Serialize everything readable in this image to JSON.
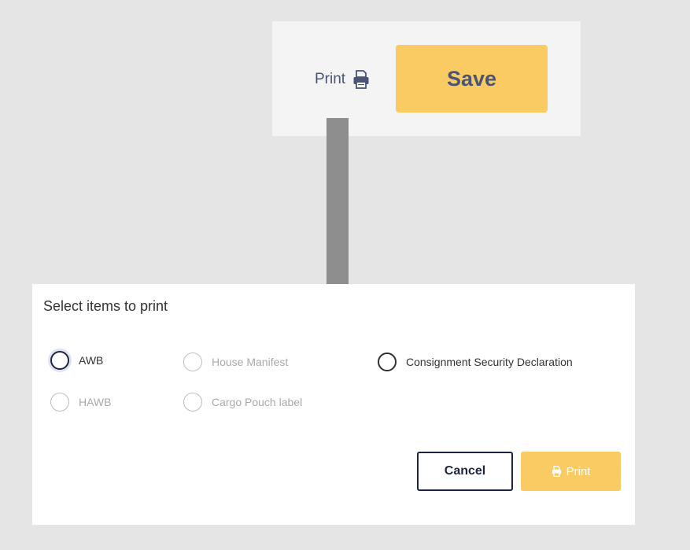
{
  "toolbar": {
    "print_label": "Print",
    "print_icon": "printer-icon",
    "save_label": "Save"
  },
  "dialog": {
    "title": "Select items to print",
    "options": [
      {
        "label": "AWB",
        "state": "enabled",
        "focused": true
      },
      {
        "label": "House Manifest",
        "state": "disabled"
      },
      {
        "label": "Consignment Security Declaration",
        "state": "enabled"
      },
      {
        "label": "HAWB",
        "state": "disabled"
      },
      {
        "label": "Cargo Pouch label",
        "state": "disabled"
      }
    ],
    "cancel_label": "Cancel",
    "print_label": "Print",
    "print_icon": "printer-icon"
  },
  "annotation": {
    "arrow_icon": "down-arrow-icon"
  },
  "colors": {
    "background": "#e5e5e5",
    "panel": "#f4f4f4",
    "accent_yellow": "#fbcb63",
    "navy": "#1d2440",
    "text_slate": "#4a5576",
    "disabled_text": "#a9a9a9",
    "arrow_gray": "#8e8e8e"
  }
}
